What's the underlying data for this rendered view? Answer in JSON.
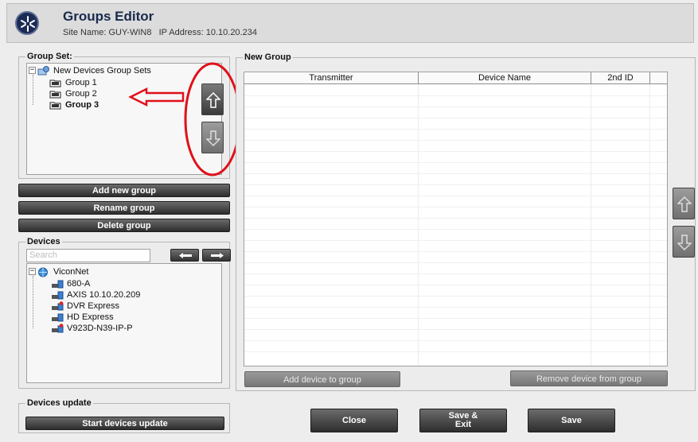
{
  "header": {
    "title": "Groups Editor",
    "subtitle": "Site Name: GUY-WIN8   IP Address: 10.10.20.234"
  },
  "group_set": {
    "title": "Group Set:",
    "root_label": "New Devices Group Sets",
    "groups": [
      "Group 1",
      "Group 2",
      "Group 3"
    ],
    "selected": "Group 3",
    "buttons": {
      "add": "Add new group",
      "rename": "Rename group",
      "delete": "Delete group"
    }
  },
  "devices": {
    "title": "Devices",
    "search_placeholder": "Search",
    "root_label": "ViconNet",
    "items": [
      "680-A",
      "AXIS 10.10.20.209",
      "DVR Express",
      "HD Express",
      "V923D-N39-IP-P"
    ]
  },
  "devices_update": {
    "title": "Devices update",
    "button": "Start devices update"
  },
  "new_group": {
    "title": "New Group",
    "columns": [
      "Transmitter",
      "Device Name",
      "2nd ID"
    ],
    "add_button": "Add device to group",
    "remove_button": "Remove device from group"
  },
  "footer": {
    "close": "Close",
    "save_exit_line1": "Save &",
    "save_exit_line2": "Exit",
    "save": "Save"
  },
  "colors": {
    "annotation_red": "#e0101a",
    "header_title": "#1a2a4d"
  }
}
